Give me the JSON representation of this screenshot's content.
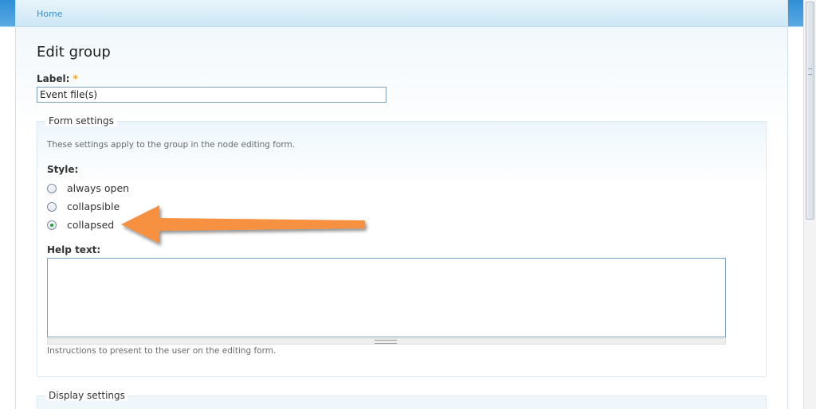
{
  "breadcrumb": {
    "home": "Home"
  },
  "page_title": "Edit group",
  "label_field": {
    "label": "Label:",
    "required_marker": "*",
    "value": "Event file(s)"
  },
  "form_settings": {
    "legend": "Form settings",
    "description": "These settings apply to the group in the node editing form.",
    "style_label": "Style:",
    "style_options": [
      {
        "label": "always open",
        "checked": false
      },
      {
        "label": "collapsible",
        "checked": false
      },
      {
        "label": "collapsed",
        "checked": true
      }
    ],
    "help_label": "Help text:",
    "help_value": "",
    "help_description": "Instructions to present to the user on the editing form."
  },
  "display_settings": {
    "legend": "Display settings"
  },
  "colors": {
    "link": "#3d8fc8",
    "header_blue": "#2f8fd6",
    "arrow": "#f5913f",
    "radio_checked": "#2a9d3a"
  }
}
